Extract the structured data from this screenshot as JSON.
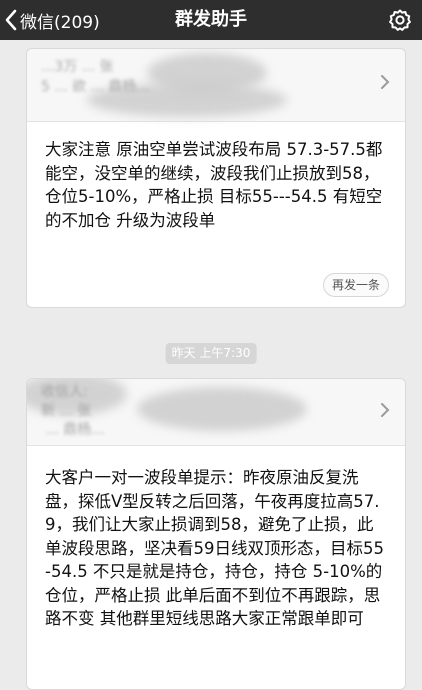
{
  "header": {
    "back_label": "微信(209)",
    "title": "群发助手",
    "icons": {
      "back": "chevron-left-icon",
      "settings": "gear-icon"
    }
  },
  "messages": [
    {
      "recipients": "...3万 ... 张\n5 ... 欲 ... 鼎杨...",
      "text": "大家注意 原油空单尝试波段布局 57.3-57.5都能空，没空单的继续，波段我们止损放到58，仓位5-10%，严格止损 目标55---54.5 有短空的不加仓 升级为波段单",
      "resend_label": "再发一条"
    },
    {
      "time": "昨天 上午7:30",
      "recipients": "收信人:\n新 ... 张\n ... 鼎杨...",
      "text": "大客户一对一波段单提示：昨夜原油反复洗盘，探低V型反转之后回落，午夜再度拉高57.9，我们让大家止损调到58，避免了止损，此单波段思路，坚决看59日线双顶形态，目标55-54.5  不只是就是持仓，持仓，持仓  5-10%的仓位，严格止损  此单后面不到位不再跟踪，思路不变  其他群里短线思路大家正常跟单即可"
    }
  ],
  "colors": {
    "header_bg": "#2e2e2e",
    "page_bg": "#ebebeb",
    "card_bg": "#ffffff"
  }
}
